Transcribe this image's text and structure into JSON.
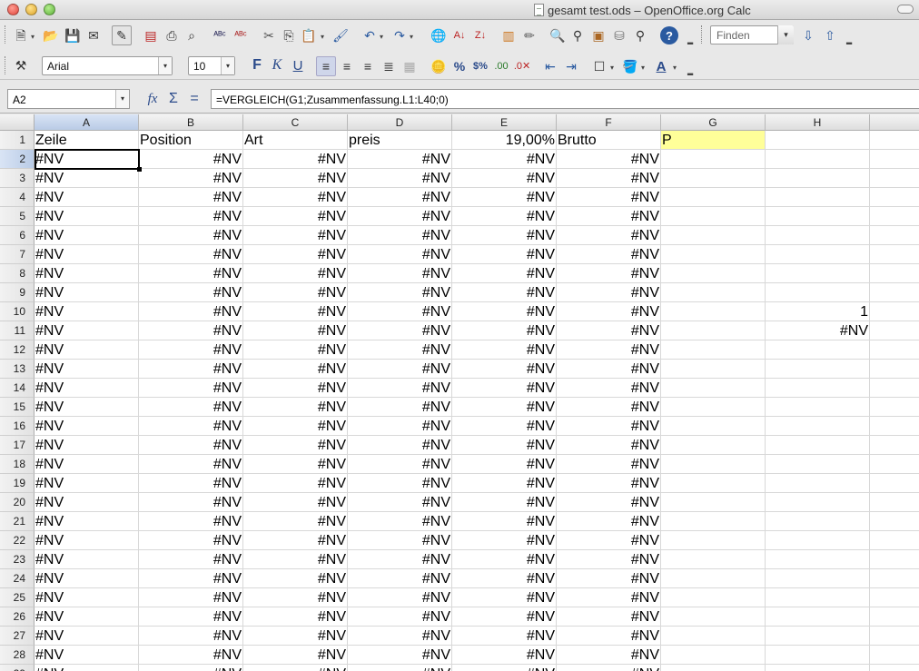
{
  "window": {
    "title": "gesamt test.ods – OpenOffice.org Calc"
  },
  "toolbar": {
    "find_placeholder": "Finden",
    "font_name": "Arial",
    "font_size": "10",
    "percent_label": "%",
    "currency_label": "$%"
  },
  "formula_bar": {
    "cell_ref": "A2",
    "fx_label": "fx",
    "sum_label": "Σ",
    "equals_label": "=",
    "formula": "=VERGLEICH(G1;Zusammenfassung.L1:L40;0)"
  },
  "sheet": {
    "columns": [
      "A",
      "B",
      "C",
      "D",
      "E",
      "F",
      "G",
      "H"
    ],
    "active_column": "A",
    "active_row": 2,
    "header_row": {
      "A": "Zeile",
      "B": "Position",
      "C": "Art",
      "D": "preis",
      "E": "19,00%",
      "F": "Brutto",
      "G": "P"
    },
    "error_value": "#NV",
    "error_rows": [
      2,
      3,
      4,
      5,
      6,
      7,
      8,
      9,
      10,
      11,
      12,
      13,
      14,
      15,
      16,
      17,
      18,
      19,
      20,
      21,
      22,
      23,
      24,
      25,
      26,
      27,
      28
    ],
    "column_H": {
      "10": "1",
      "11": "#NV"
    },
    "highlight_color": "#ffff99",
    "partial_row_29_text": "#NV"
  }
}
